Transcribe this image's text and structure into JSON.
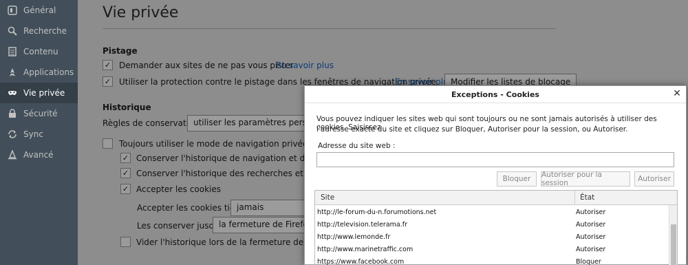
{
  "sidebar": {
    "items": [
      {
        "label": "Général",
        "icon": "general-icon",
        "selected": false
      },
      {
        "label": "Recherche",
        "icon": "search-icon",
        "selected": false
      },
      {
        "label": "Contenu",
        "icon": "document-icon",
        "selected": false
      },
      {
        "label": "Applications",
        "icon": "rocket-icon",
        "selected": false
      },
      {
        "label": "Vie privée",
        "icon": "mask-icon",
        "selected": true
      },
      {
        "label": "Sécurité",
        "icon": "lock-icon",
        "selected": false
      },
      {
        "label": "Sync",
        "icon": "sync-icon",
        "selected": false
      },
      {
        "label": "Avancé",
        "icon": "wizard-hat-icon",
        "selected": false
      }
    ]
  },
  "main": {
    "title": "Vie privée",
    "tracking": {
      "title": "Pistage",
      "dnt_label": "Demander aux sites de ne pas vous pister",
      "dnt_checked": true,
      "learn_more_1": "En savoir plus",
      "protection_label": "Utiliser la protection contre le pistage dans les fenêtres de navigation privée",
      "protection_checked": true,
      "learn_more_2": "En savoir plus",
      "block_lists_button": "Modifier les listes de blocage"
    },
    "history": {
      "title": "Historique",
      "retention_label": "Règles de conservation :",
      "retention_value": "utiliser les paramètres personnal",
      "always_private_label": "Toujours utiliser le mode de navigation privée",
      "always_private_checked": false,
      "keep_nav_history_label": "Conserver l'historique de navigation et des téléch",
      "keep_nav_history_checked": true,
      "keep_search_history_label": "Conserver l'historique des recherches et des form",
      "keep_search_history_checked": true,
      "accept_cookies_label": "Accepter les cookies",
      "accept_cookies_checked": true,
      "third_party_label": "Accepter les cookies tiers :",
      "third_party_value": "jamais",
      "keep_until_label": "Les conserver jusqu'à :",
      "keep_until_value": "la fermeture de Firefox",
      "clear_on_close_label": "Vider l'historique lors de la fermeture de Firefox",
      "clear_on_close_checked": false
    }
  },
  "modal": {
    "title": "Exceptions - Cookies",
    "description_line1": "Vous pouvez indiquer les sites web qui sont toujours ou ne sont jamais autorisés à utiliser des cookies. Saisissez",
    "description_line2": "l'adresse exacte du site et cliquez sur Bloquer, Autoriser pour la session, ou Autoriser.",
    "address_label": "Adresse du site web :",
    "address_value": "",
    "buttons": {
      "block": "Bloquer",
      "allow_session": "Autoriser pour la session",
      "allow": "Autoriser"
    },
    "table": {
      "headers": {
        "site": "Site",
        "state": "État"
      },
      "rows": [
        {
          "site": "http://le-forum-du-n.forumotions.net",
          "state": "Autoriser"
        },
        {
          "site": "http://television.telerama.fr",
          "state": "Autoriser"
        },
        {
          "site": "http://www.lemonde.fr",
          "state": "Autoriser"
        },
        {
          "site": "http://www.marinetraffic.com",
          "state": "Autoriser"
        },
        {
          "site": "https://www.facebook.com",
          "state": "Bloquer"
        }
      ]
    }
  },
  "colors": {
    "sidebar_bg": "#424f5a",
    "sidebar_selected": "#343f48",
    "link": "#0b3b78",
    "modal_bg": "#ffffff"
  }
}
